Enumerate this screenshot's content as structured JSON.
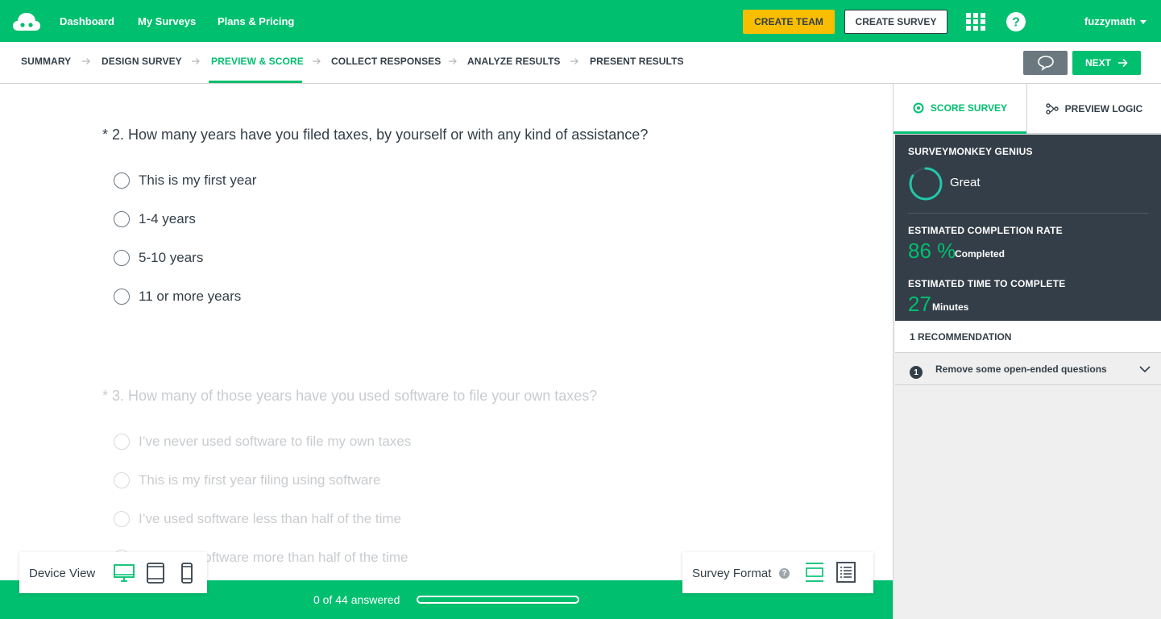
{
  "topbar": {
    "nav": [
      "Dashboard",
      "My Surveys",
      "Plans & Pricing"
    ],
    "create_team": "CREATE TEAM",
    "create_survey": "CREATE SURVEY",
    "user": "fuzzymath",
    "colors": {
      "brand": "#00bf6f",
      "team_button": "#f9be00"
    }
  },
  "steps": {
    "items": [
      "SUMMARY",
      "DESIGN SURVEY",
      "PREVIEW & SCORE",
      "COLLECT RESPONSES",
      "ANALYZE RESULTS",
      "PRESENT RESULTS"
    ],
    "active": "PREVIEW & SCORE",
    "next_label": "NEXT"
  },
  "questions": [
    {
      "title": "* 2. How many years have you filed taxes, by yourself or with any kind of assistance?",
      "options": [
        "This is my first year",
        "1-4 years",
        "5-10 years",
        "11 or more years"
      ]
    },
    {
      "title": "* 3. How many of those years have you used software to file your own taxes?",
      "options": [
        "I’ve never used software to file my own taxes",
        "This is my first year filing using software",
        "I’ve used software less than half of the time",
        "I’ve used software more than half of the time"
      ]
    }
  ],
  "progress": {
    "text": "0 of 44 answered",
    "fraction": 0
  },
  "device_view": {
    "label": "Device View",
    "icons": [
      "desktop-icon",
      "tablet-icon",
      "phone-icon"
    ]
  },
  "survey_format": {
    "label": "Survey Format",
    "help": "?",
    "icons": [
      "one-question-format-icon",
      "classic-format-icon"
    ]
  },
  "sidebar": {
    "tabs": {
      "score": "SCORE SURVEY",
      "logic": "PREVIEW LOGIC"
    },
    "genius_title": "SURVEYMONKEY GENIUS",
    "genius_rating": "Great",
    "completion_title": "ESTIMATED COMPLETION RATE",
    "completion_value": "86 %",
    "completion_unit": "Completed",
    "time_title": "ESTIMATED TIME TO COMPLETE",
    "time_value": "27",
    "time_unit": "Minutes",
    "recommendation_header": "1 RECOMMENDATION",
    "recommendation_number": "1",
    "recommendation_text": "Remove some open-ended questions"
  }
}
